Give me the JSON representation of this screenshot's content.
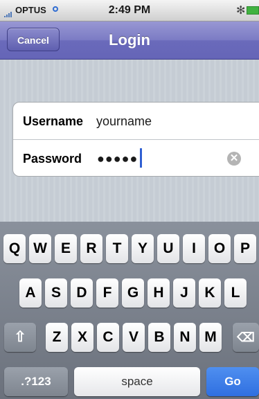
{
  "status": {
    "carrier": "OPTUS",
    "time": "2:49 PM",
    "bluetooth": "✻"
  },
  "nav": {
    "cancel": "Cancel",
    "title": "Login"
  },
  "form": {
    "username_label": "Username",
    "username_value": "yourname",
    "password_label": "Password",
    "password_value": "●●●●●",
    "clear_glyph": "✕"
  },
  "keyboard": {
    "row1": [
      "Q",
      "W",
      "E",
      "R",
      "T",
      "Y",
      "U",
      "I",
      "O",
      "P"
    ],
    "row2": [
      "A",
      "S",
      "D",
      "F",
      "G",
      "H",
      "J",
      "K",
      "L"
    ],
    "row3": [
      "Z",
      "X",
      "C",
      "V",
      "B",
      "N",
      "M"
    ],
    "shift": "⇧",
    "backspace": "⌫",
    "numbers": ".?123",
    "space": "space",
    "go": "Go"
  },
  "colors": {
    "nav": "#7b7bc4",
    "go": "#2f6fe0",
    "battery": "#41b241",
    "caret": "#2f5fd2"
  }
}
